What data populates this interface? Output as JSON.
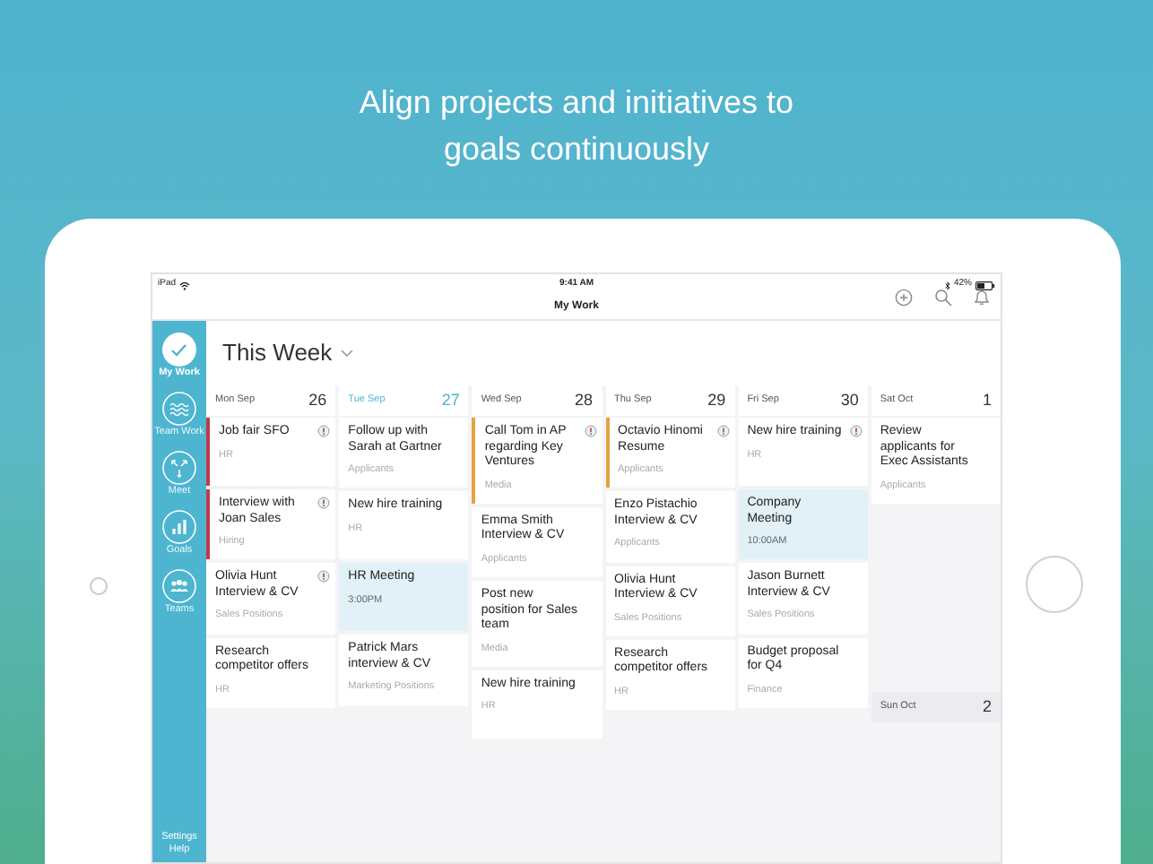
{
  "headline": "Align projects and initiatives to goals continuously",
  "status_bar": {
    "device": "iPad",
    "time": "9:41 AM",
    "battery": "42%"
  },
  "title": "My Work",
  "sidebar": {
    "items": [
      {
        "label": "My Work",
        "selected": true
      },
      {
        "label": "Team Work",
        "selected": false
      },
      {
        "label": "Meet",
        "selected": false
      },
      {
        "label": "Goals",
        "selected": false
      },
      {
        "label": "Teams",
        "selected": false
      }
    ],
    "footer": [
      "Settings",
      "Help"
    ]
  },
  "view": {
    "title": "This Week"
  },
  "columns": [
    {
      "days": [
        {
          "weekday": "Mon",
          "month": "Sep",
          "date": "26",
          "today": false,
          "cards": [
            {
              "kind": "task",
              "title": "Job fair SFO",
              "sub": "HR",
              "flagged": true,
              "color": "#c0394b"
            },
            {
              "kind": "task",
              "title": "Interview with Joan Sales",
              "sub": "Hiring",
              "flagged": true,
              "color": "#c0394b"
            },
            {
              "kind": "task",
              "title": "Olivia Hunt Interview & CV",
              "sub": "Sales Positions",
              "flagged": true
            },
            {
              "kind": "task",
              "title": "Research competitor offers",
              "sub": "HR",
              "flagged": false
            }
          ]
        }
      ]
    },
    {
      "days": [
        {
          "weekday": "Tue",
          "month": "Sep",
          "date": "27",
          "today": true,
          "cards": [
            {
              "kind": "task",
              "title": "Follow up with Sarah at Gartner",
              "sub": "Applicants",
              "flagged": false
            },
            {
              "kind": "task",
              "title": "New hire training",
              "sub": "HR",
              "flagged": false
            },
            {
              "kind": "event",
              "title": "HR Meeting",
              "sub": "3:00PM"
            },
            {
              "kind": "task",
              "title": "Patrick Mars interview & CV",
              "sub": "Marketing Positions",
              "flagged": false
            }
          ]
        }
      ]
    },
    {
      "days": [
        {
          "weekday": "Wed",
          "month": "Sep",
          "date": "28",
          "today": false,
          "cards": [
            {
              "kind": "task",
              "title": "Call Tom in AP regarding Key Ventures",
              "sub": "Media",
              "flagged": true,
              "color": "#e8a23c"
            },
            {
              "kind": "task",
              "title": "Emma Smith Interview & CV",
              "sub": "Applicants",
              "flagged": false
            },
            {
              "kind": "task",
              "title": "Post new position for Sales team",
              "sub": "Media",
              "flagged": false
            },
            {
              "kind": "task",
              "title": "New hire training",
              "sub": "HR",
              "flagged": false
            }
          ]
        }
      ]
    },
    {
      "days": [
        {
          "weekday": "Thu",
          "month": "Sep",
          "date": "29",
          "today": false,
          "cards": [
            {
              "kind": "task",
              "title": "Octavio Hinomi Resume",
              "sub": "Applicants",
              "flagged": true,
              "color": "#e8a23c"
            },
            {
              "kind": "task",
              "title": "Enzo Pistachio Interview & CV",
              "sub": "Applicants",
              "flagged": false
            },
            {
              "kind": "task",
              "title": "Olivia Hunt Interview & CV",
              "sub": "Sales Positions",
              "flagged": false
            },
            {
              "kind": "task",
              "title": "Research competitor offers",
              "sub": "HR",
              "flagged": false
            }
          ]
        }
      ]
    },
    {
      "days": [
        {
          "weekday": "Fri",
          "month": "Sep",
          "date": "30",
          "today": false,
          "cards": [
            {
              "kind": "task",
              "title": "New hire training",
              "sub": "HR",
              "flagged": true
            },
            {
              "kind": "event",
              "title": "Company Meeting",
              "sub": "10:00AM"
            },
            {
              "kind": "task",
              "title": "Jason Burnett Interview & CV",
              "sub": "Sales Positions",
              "flagged": false
            },
            {
              "kind": "task",
              "title": "Budget proposal for Q4",
              "sub": "Finance",
              "flagged": false
            }
          ]
        }
      ]
    },
    {
      "days": [
        {
          "weekday": "Sat",
          "month": "Oct",
          "date": "1",
          "today": false,
          "cards": [
            {
              "kind": "task",
              "title": "Review applicants for Exec Assistants",
              "sub": "Applicants",
              "flagged": false
            }
          ]
        },
        {
          "weekday": "Sun",
          "month": "Oct",
          "date": "2",
          "today": false
        }
      ]
    }
  ]
}
